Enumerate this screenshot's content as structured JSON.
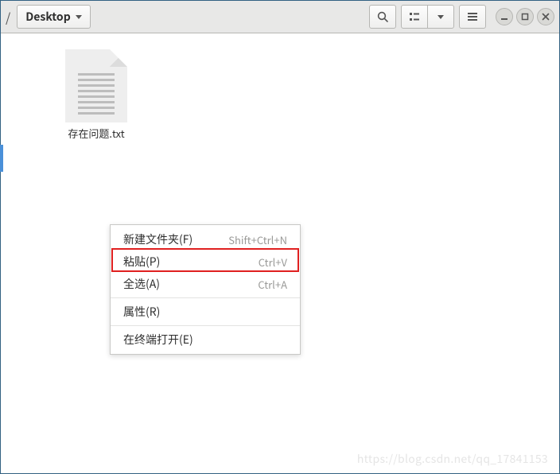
{
  "toolbar": {
    "path_separator": "/",
    "location_label": "Desktop"
  },
  "file": {
    "name": "存在问题.txt"
  },
  "context_menu": {
    "items": [
      {
        "label": "新建文件夹(F)",
        "accel": "Shift+Ctrl+N"
      },
      {
        "label": "粘贴(P)",
        "accel": "Ctrl+V",
        "highlighted": true
      },
      {
        "label": "全选(A)",
        "accel": "Ctrl+A"
      },
      {
        "label": "属性(R)",
        "accel": ""
      },
      {
        "label": "在终端打开(E)",
        "accel": ""
      }
    ]
  },
  "watermark": "https://blog.csdn.net/qq_17841153"
}
